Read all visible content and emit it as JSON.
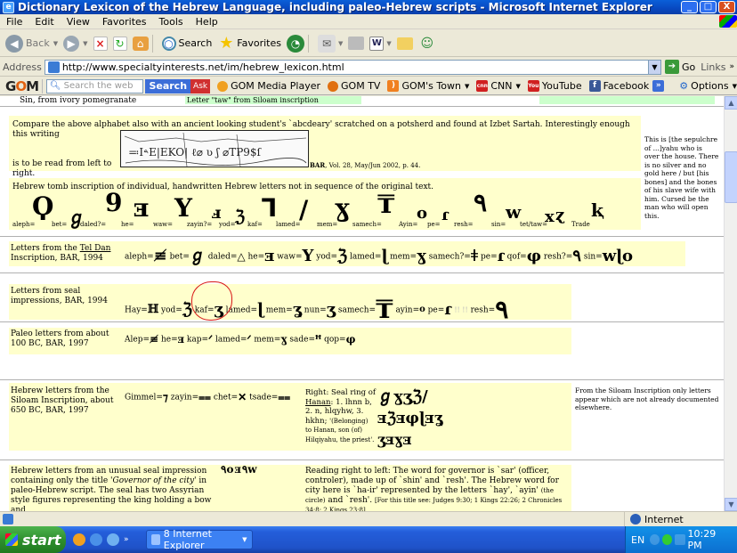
{
  "window": {
    "title": "Dictionary Lexicon of the Hebrew Language, including paleo-Hebrew scripts - Microsoft Internet Explorer",
    "min": "_",
    "max": "□",
    "close": "X"
  },
  "menu": [
    "File",
    "Edit",
    "View",
    "Favorites",
    "Tools",
    "Help"
  ],
  "toolbar": {
    "back": "Back",
    "search": "Search",
    "favorites": "Favorites"
  },
  "address": {
    "label": "Address",
    "url": "http://www.specialtyinterests.net/im/hebrew_lexicon.html",
    "go": "Go",
    "links": "Links"
  },
  "gombar": {
    "logo_a": "G",
    "logo_b": "O",
    "logo_c": "M",
    "search_placeholder": "Search the web",
    "search_btn": "Search",
    "ask": "Ask",
    "items": [
      "GOM Media Player",
      "GOM TV",
      "GOM's Town",
      "CNN",
      "YouTube",
      "Facebook"
    ],
    "options": "Options"
  },
  "content": {
    "top_line": "Sin, from ivory pomegranate",
    "top_line_b": "Letter \"taw\" from Siloam inscription",
    "izbet_text": "Compare the above alphabet also with an ancient looking student's `abcdeary' scratched on a potsherd and found at Izbet Sartah. Interestingly enough this writing",
    "izbet_text2": "is to be read from left to right.",
    "izbet_ref_bold": "BAR",
    "izbet_ref": ", Vol. 28, May/Jun 2002, p. 44.",
    "tomb_text": "Hebrew tomb inscription of individual, handwritten Hebrew letters not in sequence of the original text.",
    "tomb_letters": [
      "aleph=",
      "bet=",
      "daled?=",
      "he=",
      "waw=",
      "zayin?=",
      "yod=",
      "kaf=",
      "lamed=",
      "mem=",
      "samech=",
      "Ayin=",
      "pe=",
      "resh=",
      "sin=",
      "tet/taw=",
      "Trade"
    ],
    "tomb_note": "This is [the sepulchre of ...]yahu who is over the house. There is no silver and no gold here / but [his bones] and the bones of his slave wife with him. Cursed be the man who will open this.",
    "teldan_label_a": "Letters from the ",
    "teldan_label_link": "Tel Dan",
    "teldan_label_b": "Inscription, BAR, 1994",
    "teldan_letters": [
      "aleph=",
      "bet=",
      "daled=",
      "he=",
      "waw=",
      "yod=",
      "lamed=",
      "mem=",
      "samech?=",
      "pe=",
      "qof=",
      "resh?=",
      "sin="
    ],
    "seal_label": "Letters from seal impressions, BAR, 1994",
    "seal_letters": [
      "Hay=",
      "yod=",
      "kaf=",
      "lamed=",
      "mem=",
      "nun=",
      "samech=",
      "ayin=",
      "pe=",
      "resh="
    ],
    "paleo_label": "Paleo letters from about 100 BC, BAR, 1997",
    "paleo_letters": [
      "Alep=",
      "he=",
      "kap=",
      "lamed=",
      "mem=",
      "sade=",
      "qop="
    ],
    "siloam_label": "Hebrew letters from the Siloam Inscription, about 650 BC, BAR, 1997",
    "siloam_letters": [
      "Gimmel=",
      "zayin=",
      "chet=",
      "tsade="
    ],
    "hanan_a": "Right: Seal ring of",
    "hanan_link": "Hanan",
    "hanan_b": ": 1. lhnn b,",
    "hanan_c": "2. n, hlqyhw, 3.",
    "hanan_d": "hkhn;",
    "hanan_e": "'(Belonging)",
    "hanan_f": "to Hanan, son (of)",
    "hanan_g": "Hilqiyahu, the priest'.",
    "siloam_note": "From the Siloam Inscription only letters appear which are not already documented elsewhere.",
    "seal2_a": "Hebrew letters from an unusual seal impression containing only the title ",
    "seal2_i": "'Governor of the city'",
    "seal2_b": " in paleo-Hebrew script. The seal has two Assyrian style figures representing the king holding a bow and",
    "seal2_right_a": "Reading right to left: The word for governor is `sar' (officer, controler), made up of `shin' and `resh'. The Hebrew word for city here is `ha-ir' represented by the letters `hay', `ayin'",
    "seal2_right_small": "(the circle)",
    "seal2_right_b": " and `resh'. ",
    "seal2_right_refs": "[For this title see: Judges 9:30; 1 Kings 22:26; 2 Chronicles 34:8; 2 Kings 23:8]"
  },
  "status": {
    "zone": "Internet"
  },
  "taskbar": {
    "start": "start",
    "button": "8 Internet Explorer",
    "lang": "EN",
    "clock": "10:29 PM"
  }
}
